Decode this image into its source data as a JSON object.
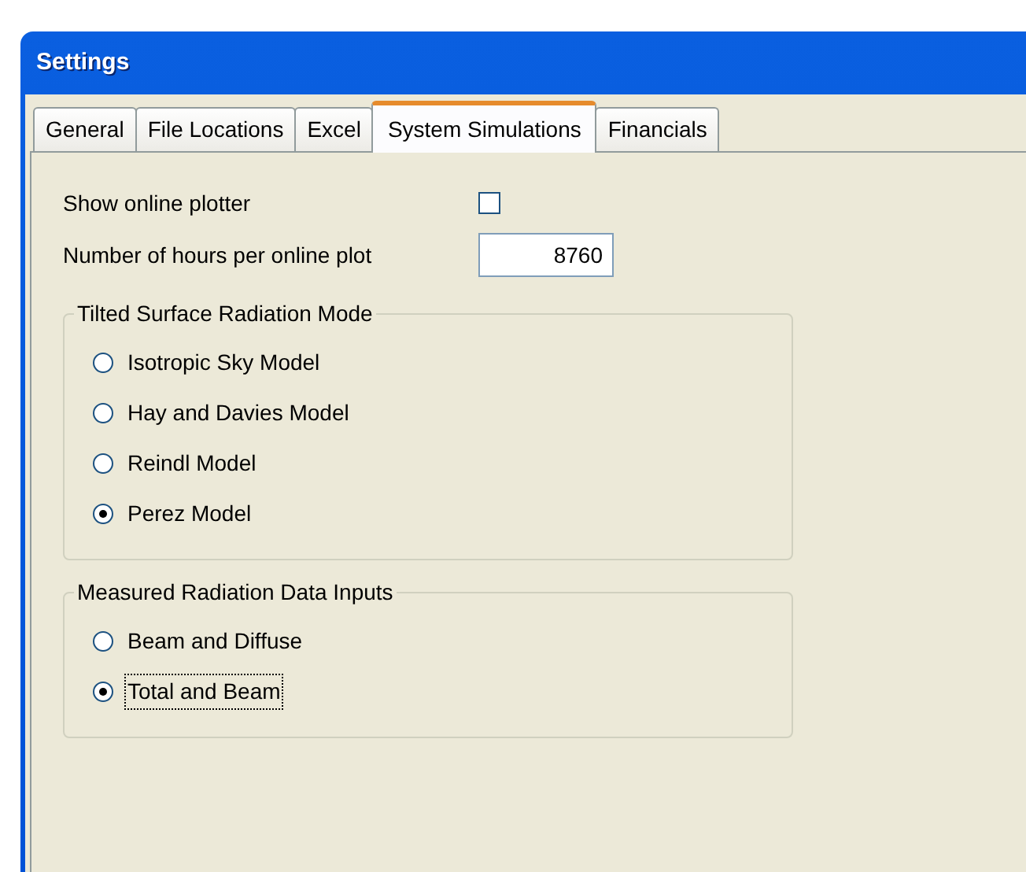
{
  "window": {
    "title": "Settings"
  },
  "tabs": [
    {
      "label": "General",
      "selected": false
    },
    {
      "label": "File Locations",
      "selected": false
    },
    {
      "label": "Excel",
      "selected": false
    },
    {
      "label": "System Simulations",
      "selected": true
    },
    {
      "label": "Financials",
      "selected": false
    }
  ],
  "show_online_plotter": {
    "label": "Show online plotter",
    "checked": false
  },
  "hours_per_plot": {
    "label": "Number of hours per online plot",
    "value": "8760"
  },
  "groups": [
    {
      "title": "Tilted Surface Radiation Mode",
      "options": [
        {
          "label": "Isotropic Sky Model",
          "selected": false,
          "focused": false
        },
        {
          "label": "Hay and Davies Model",
          "selected": false,
          "focused": false
        },
        {
          "label": "Reindl Model",
          "selected": false,
          "focused": false
        },
        {
          "label": "Perez Model",
          "selected": true,
          "focused": false
        }
      ]
    },
    {
      "title": "Measured Radiation Data Inputs",
      "options": [
        {
          "label": "Beam and Diffuse",
          "selected": false,
          "focused": false
        },
        {
          "label": "Total and Beam",
          "selected": true,
          "focused": true
        }
      ]
    }
  ]
}
